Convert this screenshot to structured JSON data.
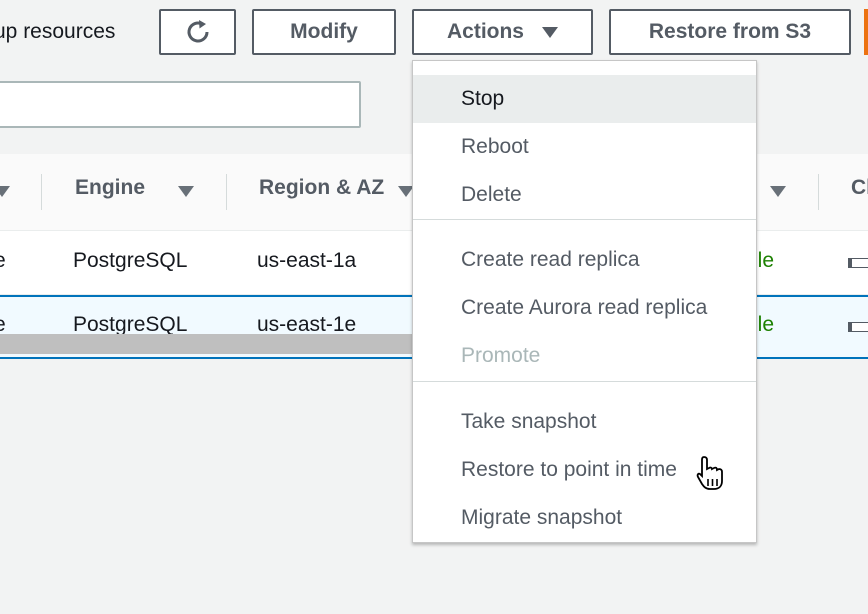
{
  "toolbar": {
    "label": "up resources",
    "refresh_icon": "refresh-icon",
    "modify": "Modify",
    "actions": "Actions",
    "restore": "Restore from S3"
  },
  "filter": {
    "value": "",
    "placeholder": ""
  },
  "table": {
    "headers": [
      "Engine",
      "Region & AZ",
      "Cl"
    ],
    "rows": [
      {
        "lead": "e",
        "engine": "PostgreSQL",
        "region": "us-east-1a",
        "status": "ble"
      },
      {
        "lead": "e",
        "engine": "PostgreSQL",
        "region": "us-east-1e",
        "status": "ble"
      }
    ]
  },
  "menu": {
    "group1": [
      "Stop",
      "Reboot",
      "Delete"
    ],
    "group2": [
      "Create read replica",
      "Create Aurora read replica",
      "Promote"
    ],
    "group3": [
      "Take snapshot",
      "Restore to point in time",
      "Migrate snapshot"
    ],
    "hovered": "Stop",
    "disabled": "Promote"
  },
  "colors": {
    "accent": "#ec7211",
    "status_ok": "#1d8102",
    "selection": "#0073bb"
  }
}
